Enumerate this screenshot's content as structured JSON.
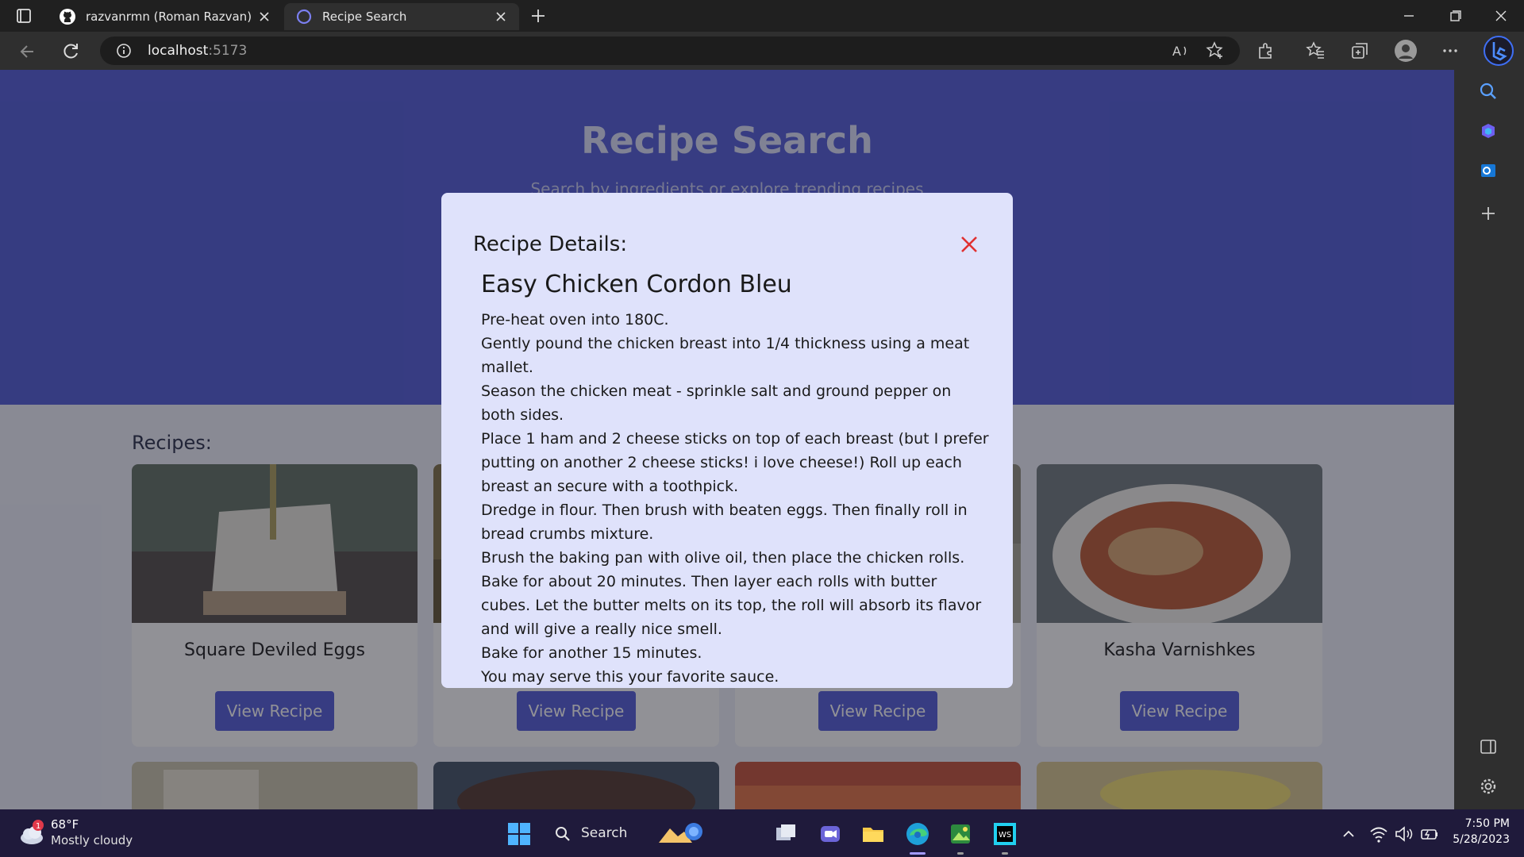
{
  "browser": {
    "tabs": [
      {
        "title": "razvanrmn (Roman Razvan)",
        "active": false,
        "icon": "github-icon"
      },
      {
        "title": "Recipe Search",
        "active": true,
        "icon": "loading-icon"
      }
    ],
    "url_host": "localhost",
    "url_port": ":5173"
  },
  "page": {
    "hero_title": "Recipe Search",
    "hero_subtitle": "Search by ingredients or explore trending recipes",
    "recipes_heading": "Recipes:",
    "cards": [
      {
        "title": "Square Deviled Eggs",
        "button": "View Recipe"
      },
      {
        "title": "",
        "button": "View Recipe"
      },
      {
        "title": "",
        "button": "View Recipe"
      },
      {
        "title": "Kasha Varnishkes",
        "button": "View Recipe"
      }
    ]
  },
  "modal": {
    "heading": "Recipe Details:",
    "recipe_name": "Easy Chicken Cordon Bleu",
    "steps": [
      "Pre-heat oven into 180C.",
      "Gently pound the chicken breast into 1/4 thickness using a meat mallet.",
      "Season the chicken meat - sprinkle salt and ground pepper on both sides.",
      "Place 1 ham and 2 cheese sticks on top of each breast (but I prefer putting on another 2 cheese sticks! i love cheese!) Roll up each breast an secure with a toothpick.",
      "Dredge in flour. Then brush with beaten eggs. Then finally roll in bread crumbs mixture.",
      "Brush the baking pan with olive oil, then place the chicken rolls.",
      "Bake for about 20 minutes. Then layer each rolls with butter cubes. Let the butter melts on its top, the roll will absorb its flavor and will give a really nice smell.",
      "Bake for another 15 minutes.",
      "You may serve this your favorite sauce."
    ]
  },
  "taskbar": {
    "weather_temp": "68°F",
    "weather_desc": "Mostly cloudy",
    "weather_badge": "1",
    "search_label": "Search",
    "time": "7:50 PM",
    "date": "5/28/2023"
  },
  "colors": {
    "accent": "#4a55d6",
    "modal_bg": "#dfe2fb",
    "close_red": "#e03131"
  }
}
